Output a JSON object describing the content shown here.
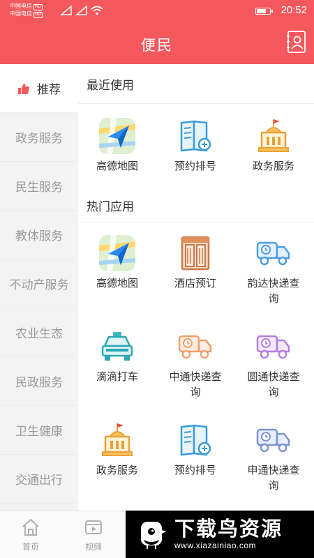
{
  "status_bar": {
    "carrier_1": "中国电信",
    "carrier_1_tag": "HD",
    "carrier_2": "中国电信",
    "carrier_2_tag": "HD",
    "time": "20:52",
    "battery_level": 0.75
  },
  "header": {
    "title": "便民",
    "contact_icon": "contact-book-icon"
  },
  "sidebar": {
    "items": [
      {
        "label": "推荐",
        "active": true,
        "icon": "thumbs-up-icon"
      },
      {
        "label": "政务服务",
        "active": false
      },
      {
        "label": "民生服务",
        "active": false
      },
      {
        "label": "教体服务",
        "active": false
      },
      {
        "label": "不动产服务",
        "active": false
      },
      {
        "label": "农业生态",
        "active": false
      },
      {
        "label": "民政服务",
        "active": false
      },
      {
        "label": "卫生健康",
        "active": false
      },
      {
        "label": "交通出行",
        "active": false
      }
    ]
  },
  "recent": {
    "title": "最近使用",
    "apps": [
      {
        "label": "高德地图",
        "icon": "map-navigation-icon"
      },
      {
        "label": "预约排号",
        "icon": "appointment-book-icon"
      },
      {
        "label": "政务服务",
        "icon": "government-building-icon"
      }
    ]
  },
  "hot": {
    "title": "热门应用",
    "apps": [
      {
        "label": "高德地图",
        "icon": "map-navigation-icon"
      },
      {
        "label": "酒店预订",
        "icon": "hotel-door-icon"
      },
      {
        "label": "韵达快递查询",
        "icon": "delivery-truck-icon"
      },
      {
        "label": "滴滴打车",
        "icon": "taxi-icon"
      },
      {
        "label": "中通快递查询",
        "icon": "delivery-truck-icon"
      },
      {
        "label": "圆通快递查询",
        "icon": "delivery-truck-icon"
      },
      {
        "label": "政务服务",
        "icon": "government-building-icon"
      },
      {
        "label": "预约排号",
        "icon": "appointment-book-icon"
      },
      {
        "label": "申通快递查询",
        "icon": "delivery-truck-icon"
      }
    ]
  },
  "tab_bar": {
    "tabs": [
      {
        "label": "首页",
        "icon": "home-icon"
      },
      {
        "label": "视频",
        "icon": "video-icon"
      }
    ]
  },
  "watermark": {
    "title": "下载鸟资源",
    "url": "www.xiazainiao.com"
  },
  "colors": {
    "brand_red": "#f4585c",
    "truck_blue": "#4a9de6",
    "truck_orange": "#f2a06a",
    "truck_purple": "#b47ee0",
    "truck_slate": "#7b93d6"
  }
}
